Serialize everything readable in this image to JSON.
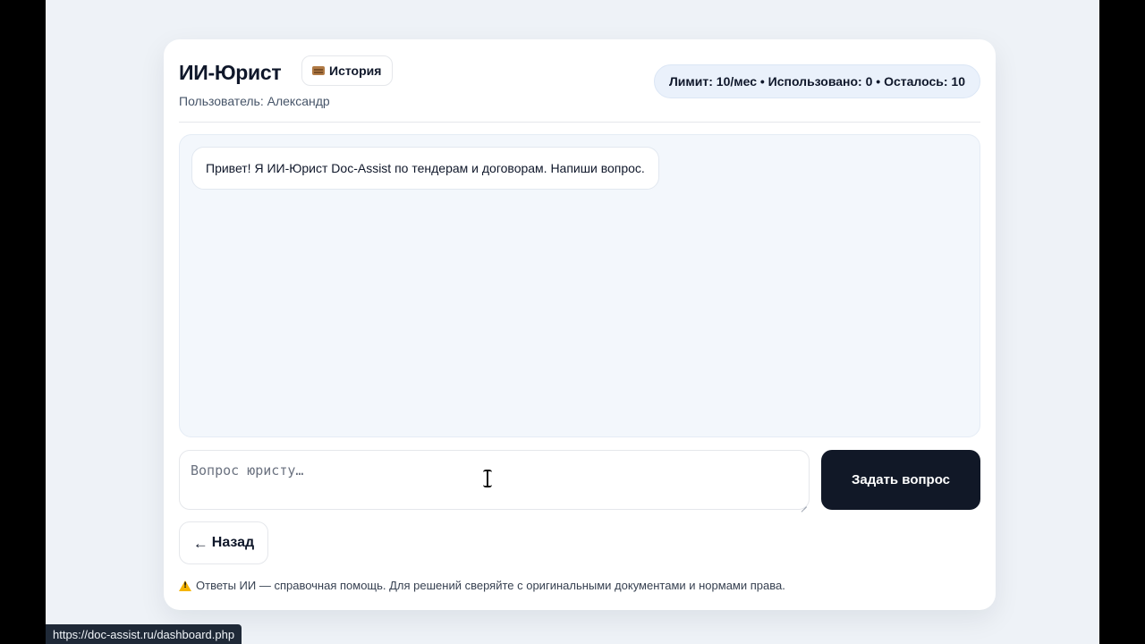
{
  "header": {
    "title": "ИИ-Юрист",
    "history_button": "История",
    "user_label": "Пользователь:",
    "user_name": "Александр",
    "limit_text": "Лимит: 10/мес • Использовано: 0 • Осталось: 10"
  },
  "chat": {
    "messages": [
      {
        "role": "assistant",
        "text": "Привет! Я ИИ-Юрист Doc-Assist по тендерам и договорам. Напиши вопрос."
      }
    ]
  },
  "composer": {
    "placeholder": "Вопрос юристу…",
    "value": "",
    "submit_label": "Задать вопрос"
  },
  "back_button": "Назад",
  "back_arrow": "←",
  "disclaimer": "Ответы ИИ — справочная помощь. Для решений сверяйте с оригинальными документами и нормами права.",
  "status_bar_url": "https://doc-assist.ru/dashboard.php",
  "icons": {
    "history": "scroll-icon",
    "back": "arrow-left-icon",
    "disclaimer": "warning-icon"
  }
}
